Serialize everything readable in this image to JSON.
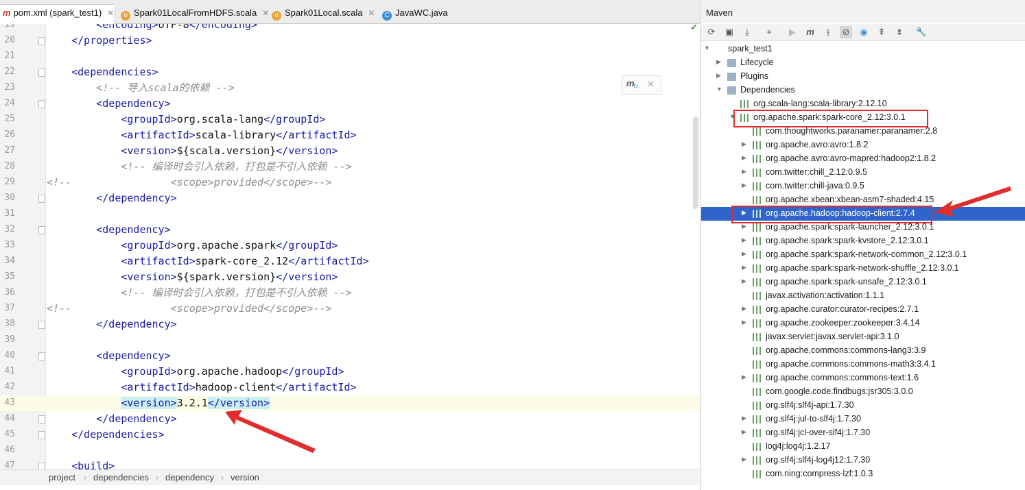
{
  "tabs": [
    {
      "label": "pom.xml (spark_test1)",
      "icon": "maven-icon",
      "active": true
    },
    {
      "label": "Spark01LocalFromHDFS.scala",
      "icon": "scala-file-icon",
      "active": false
    },
    {
      "label": "Spark01Local.scala",
      "icon": "scala-file-icon",
      "active": false
    },
    {
      "label": "JavaWC.java",
      "icon": "java-file-icon",
      "active": false
    }
  ],
  "editor": {
    "lines": [
      {
        "n": "19",
        "text": "        <encoding>UTF-8</encoding>"
      },
      {
        "n": "20",
        "text": "    </properties>"
      },
      {
        "n": "21",
        "text": ""
      },
      {
        "n": "22",
        "text": "    <dependencies>"
      },
      {
        "n": "23",
        "text": "        <!-- 导入scala的依赖 -->"
      },
      {
        "n": "24",
        "text": "        <dependency>"
      },
      {
        "n": "25",
        "text": "            <groupId>org.scala-lang</groupId>"
      },
      {
        "n": "26",
        "text": "            <artifactId>scala-library</artifactId>"
      },
      {
        "n": "27",
        "text": "            <version>${scala.version}</version>"
      },
      {
        "n": "28",
        "text": "            <!-- 编译时会引入依赖，打包是不引入依赖 -->"
      },
      {
        "n": "29",
        "text": "<!--                <scope>provided</scope>-->"
      },
      {
        "n": "30",
        "text": "        </dependency>"
      },
      {
        "n": "31",
        "text": ""
      },
      {
        "n": "32",
        "text": "        <dependency>"
      },
      {
        "n": "33",
        "text": "            <groupId>org.apache.spark</groupId>"
      },
      {
        "n": "34",
        "text": "            <artifactId>spark-core_2.12</artifactId>"
      },
      {
        "n": "35",
        "text": "            <version>${spark.version}</version>"
      },
      {
        "n": "36",
        "text": "            <!-- 编译时会引入依赖，打包是不引入依赖 -->"
      },
      {
        "n": "37",
        "text": "<!--                <scope>provided</scope>-->"
      },
      {
        "n": "38",
        "text": "        </dependency>"
      },
      {
        "n": "39",
        "text": ""
      },
      {
        "n": "40",
        "text": "        <dependency>"
      },
      {
        "n": "41",
        "text": "            <groupId>org.apache.hadoop</groupId>"
      },
      {
        "n": "42",
        "text": "            <artifactId>hadoop-client</artifactId>"
      },
      {
        "n": "43",
        "text": "            <version>3.2.1</version>"
      },
      {
        "n": "44",
        "text": "        </dependency>"
      },
      {
        "n": "45",
        "text": "    </dependencies>"
      },
      {
        "n": "46",
        "text": ""
      },
      {
        "n": "47",
        "text": "    <build>"
      }
    ]
  },
  "breadcrumb": [
    "project",
    "dependencies",
    "dependency",
    "version"
  ],
  "maven": {
    "title": "Maven",
    "toolbar": [
      "refresh-icon",
      "add-project-icon",
      "download-icon",
      "plus-icon",
      "run-icon",
      "maven-goal-icon",
      "toggle-offline-icon",
      "skip-tests-icon",
      "show-dependencies-icon",
      "collapse-all-icon",
      "expand-all-icon",
      "settings-wrench-icon"
    ],
    "tree": [
      {
        "label": "spark_test1",
        "icon": "project",
        "arrow": "down"
      },
      {
        "label": "Lifecycle",
        "icon": "folder",
        "arrow": "right"
      },
      {
        "label": "Plugins",
        "icon": "folder",
        "arrow": "right"
      },
      {
        "label": "Dependencies",
        "icon": "folder",
        "arrow": "down"
      },
      {
        "label": "org.scala-lang:scala-library:2.12.10",
        "icon": "lib",
        "arrow": ""
      },
      {
        "label": "org.apache.spark:spark-core_2.12:3.0.1",
        "icon": "lib",
        "arrow": "down"
      },
      {
        "label": "com.thoughtworks.paranamer:paranamer:2.8",
        "icon": "lib",
        "arrow": ""
      },
      {
        "label": "org.apache.avro:avro:1.8.2",
        "icon": "lib",
        "arrow": "right"
      },
      {
        "label": "org.apache.avro:avro-mapred:hadoop2:1.8.2",
        "icon": "lib",
        "arrow": "right"
      },
      {
        "label": "com.twitter:chill_2.12:0.9.5",
        "icon": "lib",
        "arrow": "right"
      },
      {
        "label": "com.twitter:chill-java:0.9.5",
        "icon": "lib",
        "arrow": "right"
      },
      {
        "label": "org.apache.xbean:xbean-asm7-shaded:4.15",
        "icon": "lib",
        "arrow": ""
      },
      {
        "label": "org.apache.hadoop:hadoop-client:2.7.4",
        "icon": "lib",
        "arrow": "right",
        "selected": true
      },
      {
        "label": "org.apache.spark:spark-launcher_2.12:3.0.1",
        "icon": "lib",
        "arrow": "right"
      },
      {
        "label": "org.apache.spark:spark-kvstore_2.12:3.0.1",
        "icon": "lib",
        "arrow": "right"
      },
      {
        "label": "org.apache.spark:spark-network-common_2.12:3.0.1",
        "icon": "lib",
        "arrow": "right"
      },
      {
        "label": "org.apache.spark:spark-network-shuffle_2.12:3.0.1",
        "icon": "lib",
        "arrow": "right"
      },
      {
        "label": "org.apache.spark:spark-unsafe_2.12:3.0.1",
        "icon": "lib",
        "arrow": "right"
      },
      {
        "label": "javax.activation:activation:1.1.1",
        "icon": "lib",
        "arrow": ""
      },
      {
        "label": "org.apache.curator:curator-recipes:2.7.1",
        "icon": "lib",
        "arrow": "right"
      },
      {
        "label": "org.apache.zookeeper:zookeeper:3.4.14",
        "icon": "lib",
        "arrow": "right"
      },
      {
        "label": "javax.servlet:javax.servlet-api:3.1.0",
        "icon": "lib",
        "arrow": ""
      },
      {
        "label": "org.apache.commons:commons-lang3:3.9",
        "icon": "lib",
        "arrow": ""
      },
      {
        "label": "org.apache.commons:commons-math3:3.4.1",
        "icon": "lib",
        "arrow": ""
      },
      {
        "label": "org.apache.commons:commons-text:1.6",
        "icon": "lib",
        "arrow": "right"
      },
      {
        "label": "com.google.code.findbugs:jsr305:3.0.0",
        "icon": "lib",
        "arrow": ""
      },
      {
        "label": "org.slf4j:slf4j-api:1.7.30",
        "icon": "lib",
        "arrow": ""
      },
      {
        "label": "org.slf4j:jul-to-slf4j:1.7.30",
        "icon": "lib",
        "arrow": "right"
      },
      {
        "label": "org.slf4j:jcl-over-slf4j:1.7.30",
        "icon": "lib",
        "arrow": "right"
      },
      {
        "label": "log4j:log4j:1.2.17",
        "icon": "lib",
        "arrow": ""
      },
      {
        "label": "org.slf4j:slf4j-log4j12:1.7.30",
        "icon": "lib",
        "arrow": "right"
      },
      {
        "label": "com.ning:compress-lzf:1.0.3",
        "icon": "lib",
        "arrow": ""
      }
    ]
  },
  "colors": {
    "selection": "#2f65ca",
    "annotation": "#e02d2d",
    "tag": "#1a1aa6",
    "comment": "#8c8c8c"
  }
}
